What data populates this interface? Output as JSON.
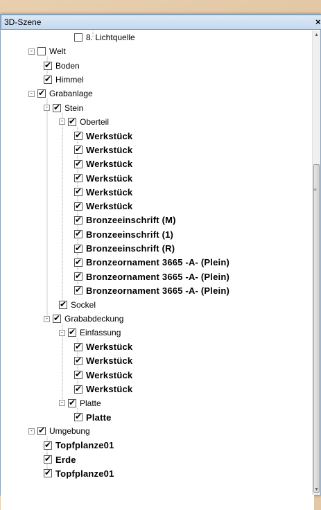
{
  "window": {
    "title": "3D-Szene"
  },
  "tree": [
    {
      "label": "8. Lichtquelle",
      "level": 4,
      "checked": false,
      "expander": null,
      "bold": false
    },
    {
      "label": "Welt",
      "level": 1,
      "checked": false,
      "expander": "-",
      "bold": false
    },
    {
      "label": "Boden",
      "level": 2,
      "checked": true,
      "expander": null,
      "bold": false
    },
    {
      "label": "Himmel",
      "level": 2,
      "checked": true,
      "expander": null,
      "bold": false
    },
    {
      "label": "Grabanlage",
      "level": 1,
      "checked": true,
      "expander": "-",
      "bold": false
    },
    {
      "label": "Stein",
      "level": 2,
      "checked": true,
      "expander": "-",
      "bold": false
    },
    {
      "label": "Oberteil",
      "level": 3,
      "checked": true,
      "expander": "-",
      "bold": false
    },
    {
      "label": "Werkstück",
      "level": 4,
      "checked": true,
      "expander": null,
      "bold": true
    },
    {
      "label": "Werkstück",
      "level": 4,
      "checked": true,
      "expander": null,
      "bold": true
    },
    {
      "label": "Werkstück",
      "level": 4,
      "checked": true,
      "expander": null,
      "bold": true
    },
    {
      "label": "Werkstück",
      "level": 4,
      "checked": true,
      "expander": null,
      "bold": true
    },
    {
      "label": "Werkstück",
      "level": 4,
      "checked": true,
      "expander": null,
      "bold": true
    },
    {
      "label": "Werkstück",
      "level": 4,
      "checked": true,
      "expander": null,
      "bold": true
    },
    {
      "label": "Bronzeeinschrift (M)",
      "level": 4,
      "checked": true,
      "expander": null,
      "bold": true
    },
    {
      "label": "Bronzeeinschrift (1)",
      "level": 4,
      "checked": true,
      "expander": null,
      "bold": true
    },
    {
      "label": "Bronzeeinschrift (R)",
      "level": 4,
      "checked": true,
      "expander": null,
      "bold": true
    },
    {
      "label": "Bronzeornament 3665 -A- (Plein)",
      "level": 4,
      "checked": true,
      "expander": null,
      "bold": true
    },
    {
      "label": "Bronzeornament 3665 -A- (Plein)",
      "level": 4,
      "checked": true,
      "expander": null,
      "bold": true
    },
    {
      "label": "Bronzeornament 3665 -A- (Plein)",
      "level": 4,
      "checked": true,
      "expander": null,
      "bold": true
    },
    {
      "label": "Sockel",
      "level": 3,
      "checked": true,
      "expander": null,
      "bold": false
    },
    {
      "label": "Grababdeckung",
      "level": 2,
      "checked": true,
      "expander": "-",
      "bold": false
    },
    {
      "label": "Einfassung",
      "level": 3,
      "checked": true,
      "expander": "-",
      "bold": false
    },
    {
      "label": "Werkstück",
      "level": 4,
      "checked": true,
      "expander": null,
      "bold": true
    },
    {
      "label": "Werkstück",
      "level": 4,
      "checked": true,
      "expander": null,
      "bold": true
    },
    {
      "label": "Werkstück",
      "level": 4,
      "checked": true,
      "expander": null,
      "bold": true
    },
    {
      "label": "Werkstück",
      "level": 4,
      "checked": true,
      "expander": null,
      "bold": true
    },
    {
      "label": "Platte",
      "level": 3,
      "checked": true,
      "expander": "-",
      "bold": false
    },
    {
      "label": "Platte",
      "level": 4,
      "checked": true,
      "expander": null,
      "bold": true
    },
    {
      "label": "Umgebung",
      "level": 1,
      "checked": true,
      "expander": "-",
      "bold": false
    },
    {
      "label": "Topfplanze01",
      "level": 2,
      "checked": true,
      "expander": null,
      "bold": true
    },
    {
      "label": "Erde",
      "level": 2,
      "checked": true,
      "expander": null,
      "bold": true
    },
    {
      "label": "Topfplanze01",
      "level": 2,
      "checked": true,
      "expander": null,
      "bold": true
    }
  ],
  "icons": {
    "close": "×",
    "scroll_up": "▲",
    "scroll_down": "▼",
    "grip": "≡"
  }
}
